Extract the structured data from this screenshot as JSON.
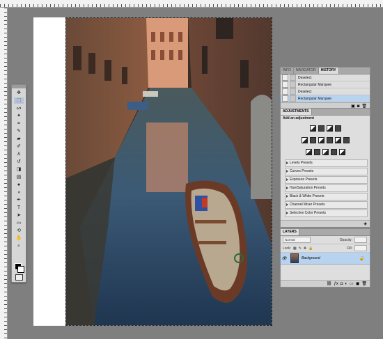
{
  "history_panel": {
    "tabs": [
      "INFO",
      "NAVIGATOR",
      "HISTORY"
    ],
    "active_tab": "HISTORY",
    "items": [
      "Deselect",
      "Rectangular Marquee",
      "Deselect",
      "Rectangular Marquee"
    ],
    "selected_index": 3
  },
  "adjustments_panel": {
    "tab": "ADJUSTMENTS",
    "subtitle": "Add an adjustment",
    "presets": [
      "Levels Presets",
      "Curves Presets",
      "Exposure Presets",
      "Hue/Saturation Presets",
      "Black & White Presets",
      "Channel Mixer Presets",
      "Selective Color Presets"
    ]
  },
  "layers_panel": {
    "tab": "LAYERS",
    "blend_mode": "Normal",
    "opacity_label": "Opacity:",
    "lock_label": "Lock:",
    "fill_label": "Fill:",
    "layer_name": "Background"
  },
  "colors": {
    "selection_blue": "#b8d3ef",
    "panel_gray": "#dedede",
    "canvas_gray": "#7f7f7f"
  }
}
